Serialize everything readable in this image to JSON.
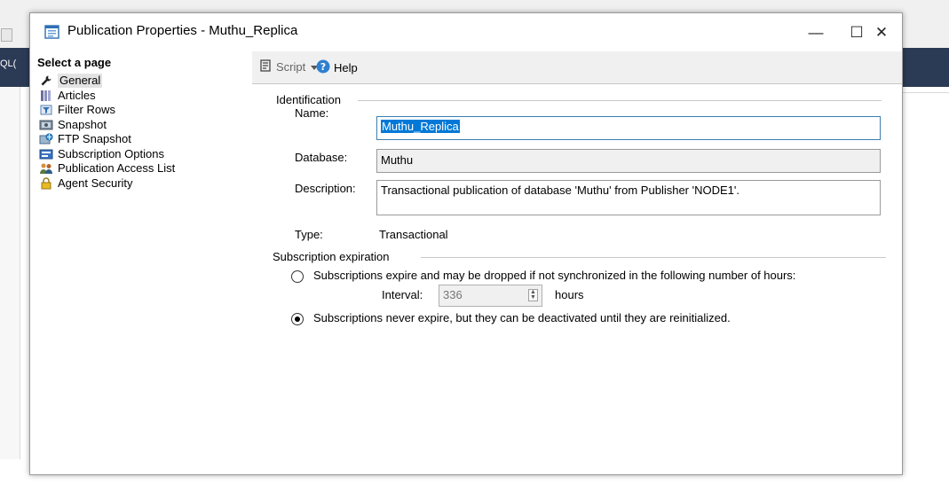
{
  "background": {
    "label_fragment": "QL("
  },
  "window": {
    "title": "Publication Properties - Muthu_Replica",
    "minimize_glyph": "—",
    "maximize_glyph": "☐",
    "close_glyph": "✕"
  },
  "sidebar": {
    "header": "Select a page",
    "items": [
      {
        "label": "General",
        "icon": "wrench-icon",
        "selected": true
      },
      {
        "label": "Articles",
        "icon": "articles-icon"
      },
      {
        "label": "Filter Rows",
        "icon": "filter-icon"
      },
      {
        "label": "Snapshot",
        "icon": "snapshot-icon"
      },
      {
        "label": "FTP Snapshot",
        "icon": "ftp-snapshot-icon"
      },
      {
        "label": "Subscription Options",
        "icon": "subscription-options-icon"
      },
      {
        "label": "Publication Access List",
        "icon": "users-icon"
      },
      {
        "label": "Agent Security",
        "icon": "lock-icon"
      }
    ]
  },
  "toolbar": {
    "script_label": "Script",
    "help_label": "Help"
  },
  "identification": {
    "group_label": "Identification",
    "name_label": "Name:",
    "name_value": "Muthu_Replica",
    "database_label": "Database:",
    "database_value": "Muthu",
    "description_label": "Description:",
    "description_value": "Transactional publication of database 'Muthu' from Publisher 'NODE1'.",
    "type_label": "Type:",
    "type_value": "Transactional"
  },
  "subscription_expiration": {
    "group_label": "Subscription expiration",
    "option_expire": "Subscriptions expire and may be dropped if not synchronized in the following number of hours:",
    "interval_label": "Interval:",
    "interval_value": "336",
    "interval_unit": "hours",
    "option_never": "Subscriptions never expire, but they can be deactivated until they are reinitialized.",
    "selected": "never"
  },
  "colors": {
    "selection": "#0078d7",
    "background_toolbar": "#2b3a55"
  }
}
